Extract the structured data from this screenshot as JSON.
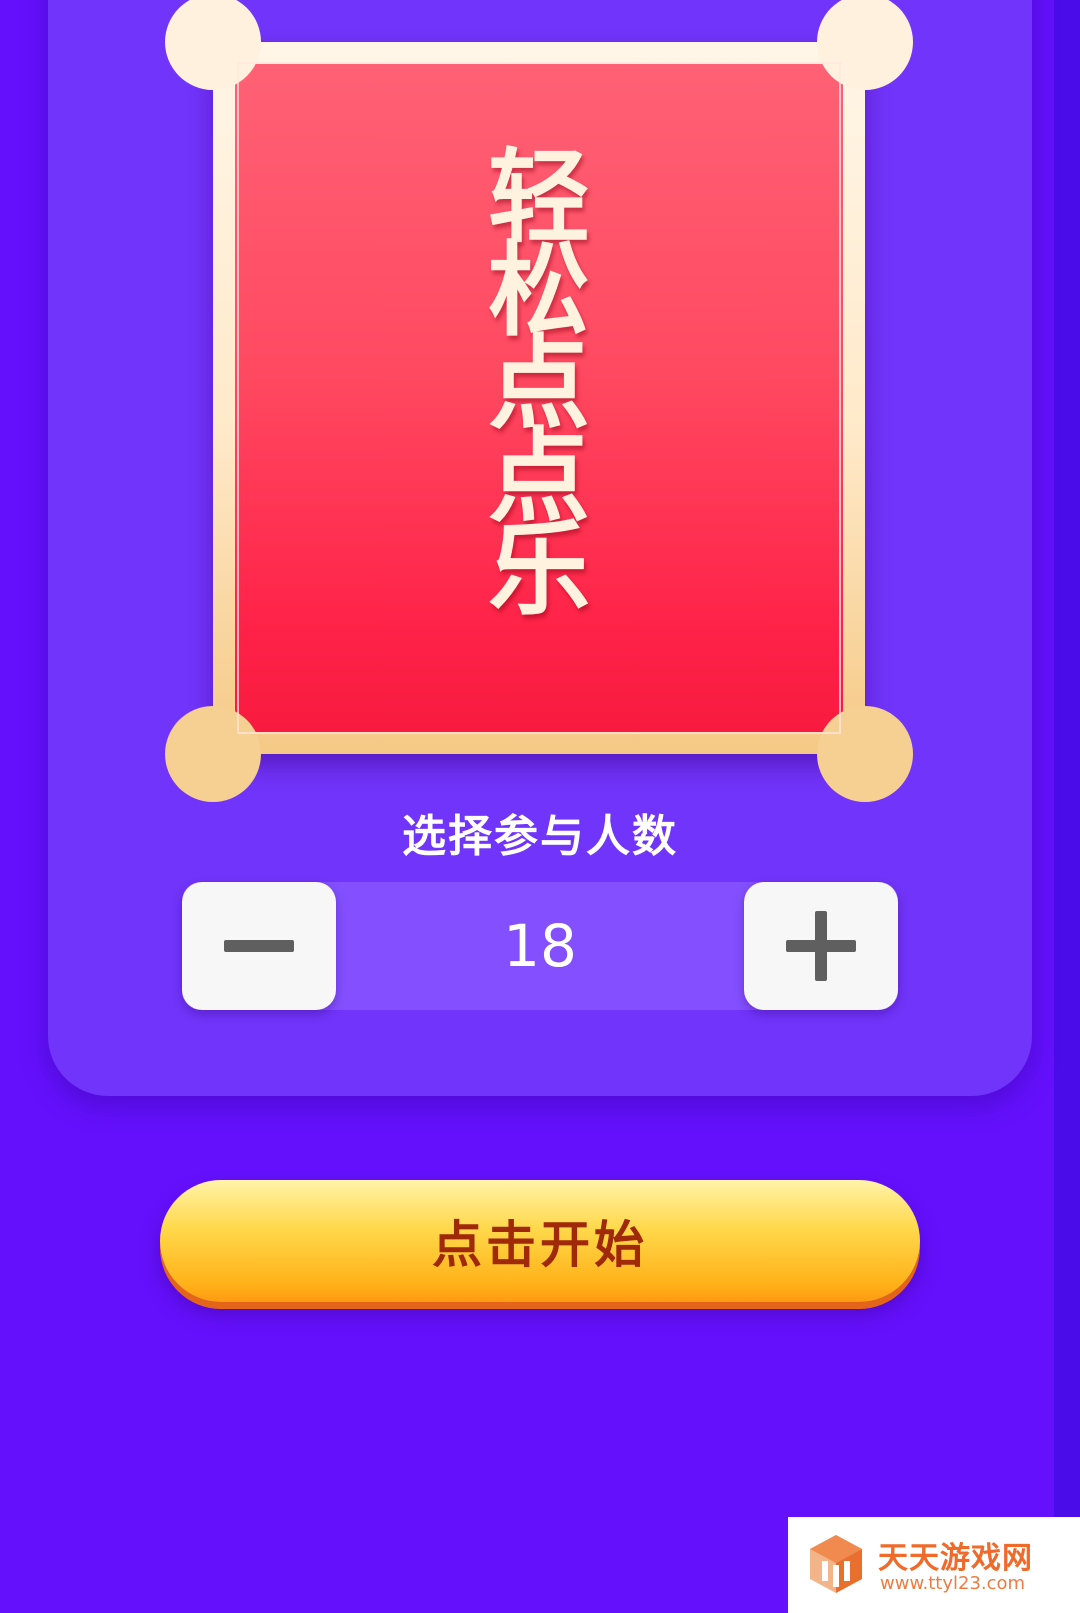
{
  "card": {
    "title": "轻松点点乐"
  },
  "player_count": {
    "label": "选择参与人数",
    "value": "18",
    "decrement_icon": "minus-icon",
    "increment_icon": "plus-icon"
  },
  "start_button": {
    "label": "点击开始"
  },
  "watermark": {
    "name": "天天游戏网",
    "url": "www.ttyl23.com",
    "logo_icon": "cube-logo-icon"
  },
  "colors": {
    "background": "#6410fc",
    "panel": "#7134fa",
    "card_red": "#ff2248",
    "card_frame": "#ffe9c9",
    "stepper_track": "#8450ff",
    "button_yellow": "#ffd84a",
    "button_text": "#a0290a",
    "watermark_orange": "#f06a2a"
  }
}
